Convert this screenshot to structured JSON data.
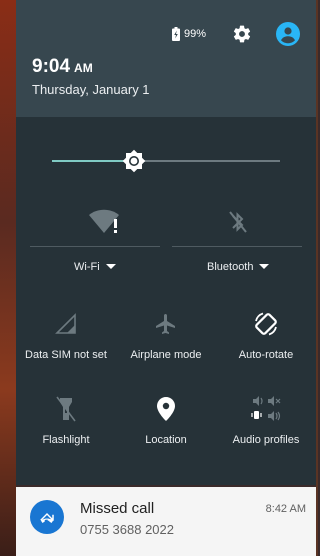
{
  "status_bar": {
    "battery_percent": "99%",
    "battery_icon": "battery-charging-icon",
    "settings_icon": "gear-icon",
    "user_icon": "account-circle-icon"
  },
  "header": {
    "time": "9:04",
    "ampm": "AM",
    "date": "Thursday, January 1"
  },
  "brightness": {
    "level": 0.36,
    "accent_color": "#80cbc4"
  },
  "quick_settings": {
    "wifi": {
      "label": "Wi-Fi",
      "icon": "wifi-no-internet-icon"
    },
    "bluetooth": {
      "label": "Bluetooth",
      "icon": "bluetooth-disabled-icon"
    },
    "tiles": [
      {
        "label": "Data SIM not set",
        "icon": "cellular-signal-icon"
      },
      {
        "label": "Airplane mode",
        "icon": "airplane-icon"
      },
      {
        "label": "Auto-rotate",
        "icon": "auto-rotate-icon"
      },
      {
        "label": "Flashlight",
        "icon": "flashlight-icon"
      },
      {
        "label": "Location",
        "icon": "location-pin-icon"
      },
      {
        "label": "Audio profiles",
        "icon": "audio-profiles-icon"
      }
    ]
  },
  "notification": {
    "title": "Missed call",
    "number": "0755 3688 2022",
    "time": "8:42 AM",
    "icon": "missed-call-icon",
    "icon_color": "#1976d2"
  }
}
